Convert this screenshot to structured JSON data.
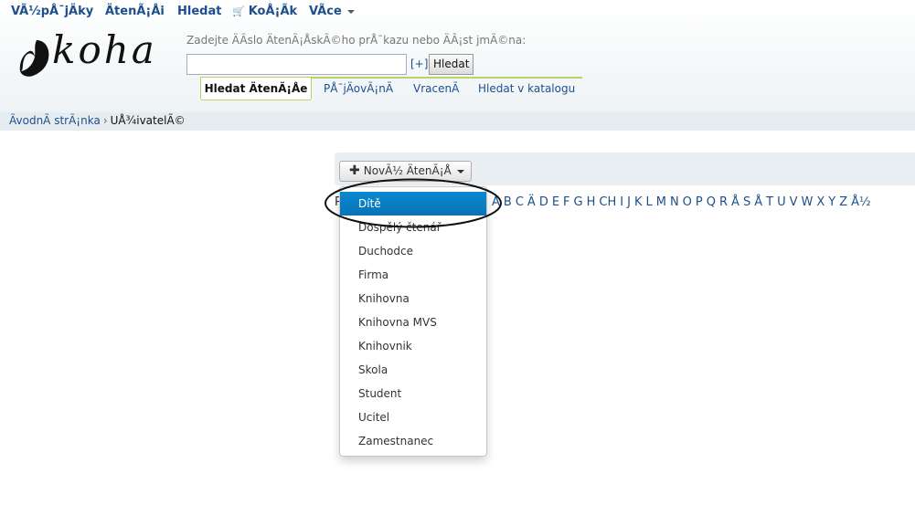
{
  "topnav": {
    "items": [
      "VÃ½pÅ¯jÄky",
      "ÄtenÃ¡Åi",
      "Hledat",
      "KoÅ¡Ã­k",
      "VÃ­ce"
    ]
  },
  "search": {
    "prompt": "Zadejte ÄÃ­slo ÄtenÃ¡ÅskÃ©ho prÅ¯kazu nebo ÄÃ¡st jmÃ©na:",
    "input_value": "",
    "advanced_label": "[+]",
    "button_label": "Hledat",
    "tabs": [
      "Hledat ÄtenÃ¡Åe",
      "PÅ¯jÄovÃ¡nÃ",
      "VracenÃ",
      "Hledat v katalogu"
    ]
  },
  "logo": {
    "text": "koha"
  },
  "breadcrumb": {
    "home": "ÃvodnÃ strÃ¡nka",
    "separator": "›",
    "current": "UÅ¾ivatelÃ©"
  },
  "toolbar": {
    "new_patron_label": "NovÃ½ ÄtenÃ¡Å"
  },
  "alphabet": {
    "lead": "P",
    "letters": [
      "A",
      "B",
      "C",
      "Ä",
      "D",
      "E",
      "F",
      "G",
      "H",
      "CH",
      "I",
      "J",
      "K",
      "L",
      "M",
      "N",
      "O",
      "P",
      "Q",
      "R",
      "Å",
      "S",
      "Å",
      "T",
      "U",
      "V",
      "W",
      "X",
      "Y",
      "Z",
      "Å½"
    ]
  },
  "dropdown": {
    "items": [
      "Dítě",
      "Dospělý čtenář",
      "Duchodce",
      "Firma",
      "Knihovna",
      "Knihovna MVS",
      "Knihovnik",
      "Skola",
      "Student",
      "Ucitel",
      "Zamestnanec"
    ],
    "active_index": 0
  },
  "colors": {
    "link": "#1e4f8c",
    "active_menu": "#0a88d0",
    "tab_border": "#b8d36a"
  }
}
